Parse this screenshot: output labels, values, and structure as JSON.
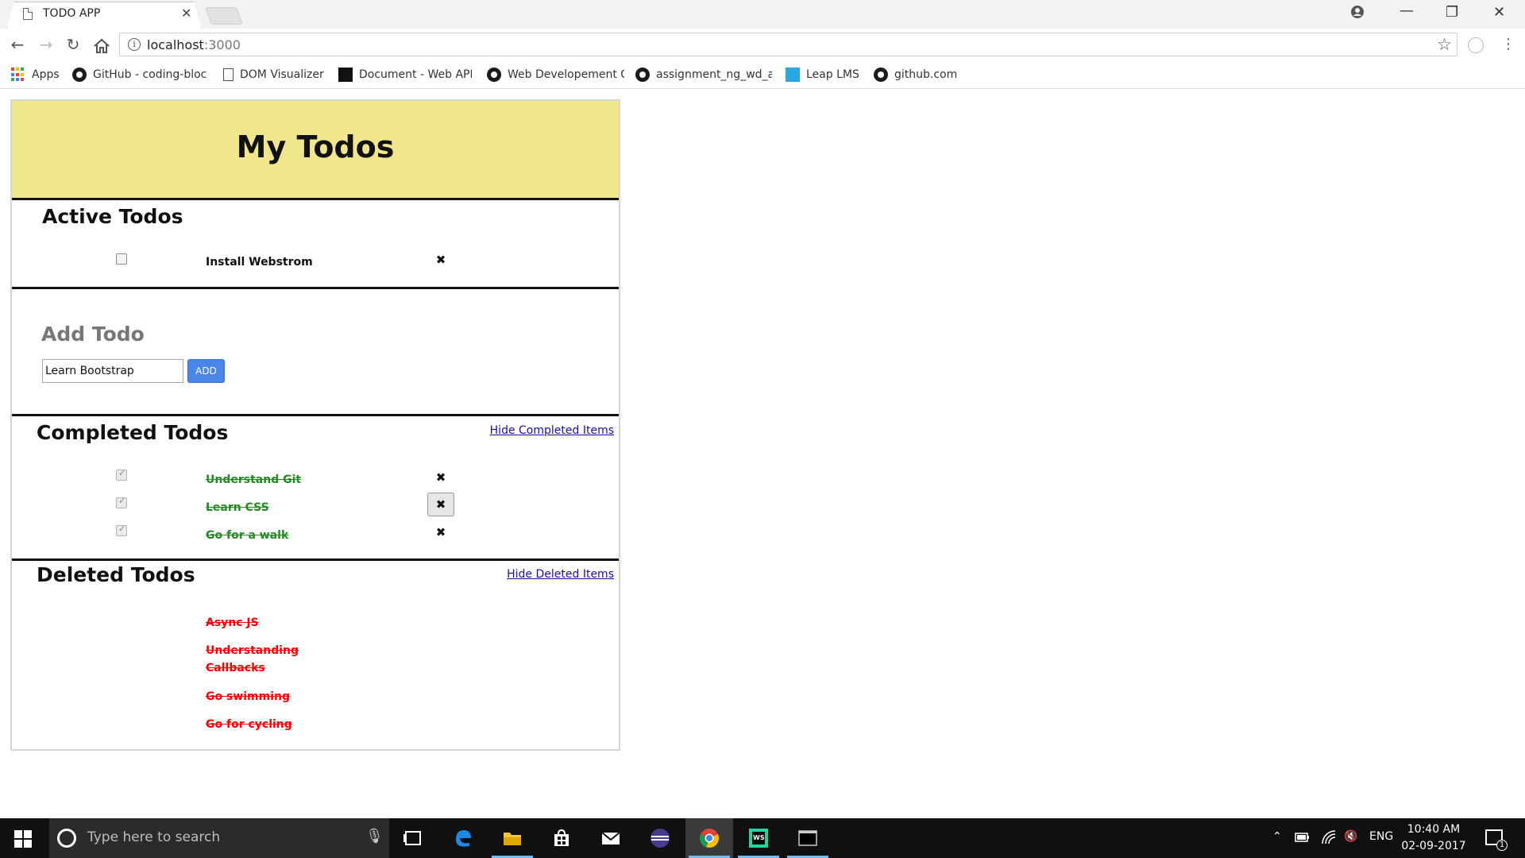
{
  "browser": {
    "tab_title": "TODO APP",
    "tab_close": "✕",
    "url_host": "localhost",
    "url_port": ":3000",
    "window_controls": {
      "minimize": "—",
      "restore": "❐",
      "close": "✕"
    },
    "bookmarks": [
      {
        "label": "Apps",
        "icon": "apps-grid-icon"
      },
      {
        "label": "GitHub - coding-bloc",
        "icon": "github-icon"
      },
      {
        "label": "DOM Visualizer",
        "icon": "document-icon"
      },
      {
        "label": "Document - Web API",
        "icon": "mdn-icon"
      },
      {
        "label": "Web Developement C",
        "icon": "github-icon"
      },
      {
        "label": "assignment_ng_wd_a",
        "icon": "github-icon"
      },
      {
        "label": "Leap LMS",
        "icon": "leap-icon"
      },
      {
        "label": "github.com",
        "icon": "github-icon"
      }
    ]
  },
  "app": {
    "title": "My Todos",
    "header_color": "#f0e68c",
    "active": {
      "title": "Active Todos",
      "items": [
        {
          "text": "Install Webstrom",
          "checked": false
        }
      ]
    },
    "add": {
      "title": "Add Todo",
      "input_value": "Learn Bootstrap",
      "button_label": "ADD"
    },
    "completed": {
      "title": "Completed Todos",
      "toggle_link": "Hide Completed Items",
      "items": [
        {
          "text": "Understand Git",
          "checked": true
        },
        {
          "text": "Learn CSS",
          "checked": true
        },
        {
          "text": "Go for a walk",
          "checked": true
        }
      ]
    },
    "deleted": {
      "title": "Deleted Todos",
      "toggle_link": "Hide Deleted Items",
      "items": [
        {
          "text": "Async JS"
        },
        {
          "text": "Understanding Callbacks"
        },
        {
          "text": "Go swimming"
        },
        {
          "text": "Go for cycling"
        }
      ]
    },
    "delete_glyph": "✖",
    "colors": {
      "completed_text": "#228b22",
      "deleted_text": "#ff0000",
      "add_button": "#4a86e8"
    }
  },
  "taskbar": {
    "search_placeholder": "Type here to search",
    "language": "ENG",
    "time": "10:40 AM",
    "date": "02-09-2017",
    "notification_count": "1"
  }
}
